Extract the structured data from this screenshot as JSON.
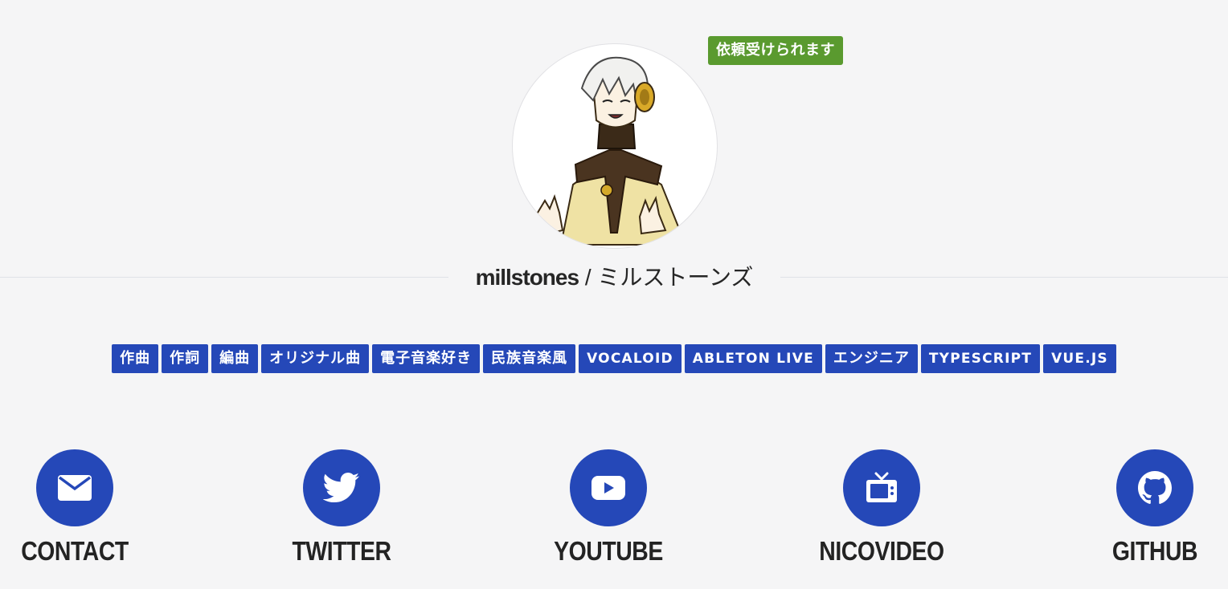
{
  "profile": {
    "availability_badge": "依頼受けられます",
    "name_latin": "millstones",
    "name_separator": " / ",
    "name_kana": "ミルストーンズ"
  },
  "tags": [
    "作曲",
    "作詞",
    "編曲",
    "オリジナル曲",
    "電子音楽好き",
    "民族音楽風",
    "VOCALOID",
    "ABLETON LIVE",
    "エンジニア",
    "TYPESCRIPT",
    "VUE.JS"
  ],
  "links": [
    {
      "label": "CONTACT",
      "icon": "mail-icon"
    },
    {
      "label": "TWITTER",
      "icon": "twitter-bird-icon"
    },
    {
      "label": "YOUTUBE",
      "icon": "youtube-play-icon"
    },
    {
      "label": "NICOVIDEO",
      "icon": "tv-icon"
    },
    {
      "label": "GITHUB",
      "icon": "github-icon"
    }
  ],
  "colors": {
    "accent": "#2548b8",
    "badge": "#5a9a2f",
    "background": "#f5f5f6",
    "text": "#232323"
  }
}
